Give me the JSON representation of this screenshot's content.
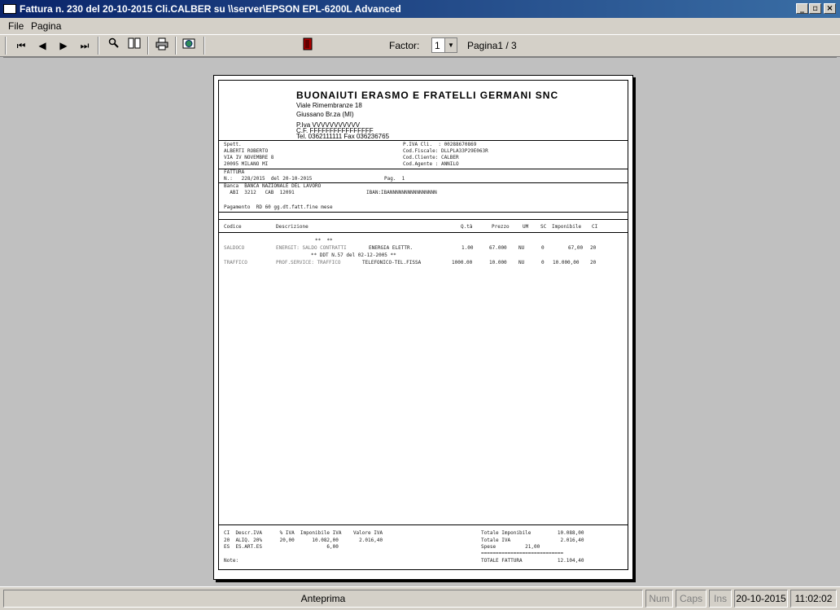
{
  "window": {
    "title": "Fattura n.  230 del 20-10-2015 Cli.CALBER su \\\\server\\EPSON EPL-6200L Advanced",
    "buttons": {
      "minimize": "_",
      "restore": "▫",
      "close": "×"
    }
  },
  "menu": {
    "file": "File",
    "pagina": "Pagina"
  },
  "toolbar": {
    "icons": [
      "first-page-icon",
      "prev-page-icon",
      "next-page-icon",
      "last-page-icon",
      "zoom-icon",
      "two-pages-icon",
      "print-icon",
      "export-icon",
      "exit-icon"
    ],
    "factor_label": "Factor:",
    "factor_value": "1",
    "page_label": "Pagina1 / 3"
  },
  "invoice": {
    "company": {
      "name": "BUONAIUTI ERASMO E FRATELLI GERMANI  SNC",
      "address": "Viale Rimembranze 18",
      "city": "Giussano Br.za (MI)",
      "piva": "P.Iva VVVVVVVVVVV",
      "cf": "C.F. FFFFFFFFFFFFFFFF",
      "tel": "Tel. 0362111111   Fax 036236765"
    },
    "customer": {
      "spett": "Spett.",
      "name": "ALBERTI ROBERTO",
      "street": "VIA IV NOVEMBRE 8",
      "city": "20095 MILANO MI",
      "piva_cli": "P.IVA Cli.  : 00288670869",
      "cod_fiscale": "Cod.Fiscale: DLLPLA33P29E063R",
      "cod_cliente": "Cod.Cliente: CALBER",
      "cod_agente": "Cod.Agente : ANNILO"
    },
    "doc": {
      "type": "FATTURA",
      "number": "N.:   228/2015  del 20-10-2015",
      "page": "Pag.  1"
    },
    "bank": {
      "banca": "Banca  BANCA NAZIONALE DEL LAVORO",
      "abi": "  ABI  3212   CAB  12091",
      "iban": "IBAN:IBANNNNNNNNNNNNNNNN",
      "pagamento": "Pagamento  RD 60 gg.dt.fatt.fine mese"
    },
    "columns": {
      "codice": "Codice",
      "descrizione": "Descrizione",
      "qta": "Q.tà",
      "prezzo": "Prezzo",
      "um": "UM",
      "sc": "SC",
      "imponibile": "Imponibile",
      "ci": "CI"
    },
    "rows": [
      {
        "marker": "**  **"
      },
      {
        "codice": "SALDOCO",
        "descr_gray": "ENERGIT: SALDO CONTRATTI",
        "descr": "ENERGIA ELETTR.",
        "qta": "1.00",
        "prezzo": "67.000",
        "um": "NU",
        "sc": "0",
        "imponibile": "67,00",
        "ci": "20"
      },
      {
        "ddt": "** DDT N.57 del 02-12-2005 **"
      },
      {
        "codice": "TRAFFICO",
        "descr_gray": "PROF.SERVICE: TRAFFICO",
        "descr": "TELEFONICO-TEL.FISSA",
        "qta": "1000.00",
        "prezzo": "10.000",
        "um": "NU",
        "sc": "0",
        "imponibile": "10.000,00",
        "ci": "20"
      }
    ],
    "footer": {
      "iva_header": "CI  Descr.IVA      % IVA  Imponibile IVA    Valore IVA",
      "iva_row1": "20  ALIQ. 20%      20,00      10.082,00       2.016,40",
      "iva_row2": "ES  ES.ART.ES                      6,00",
      "note": "Note:",
      "totale_imponibile": "Totale Imponibile         10.088,00",
      "totale_iva": "Totale IVA                 2.016,40",
      "spese": "Spese          21,00",
      "separator": "============================",
      "totale_fattura": "TOTALE FATTURA            12.104,40"
    }
  },
  "status": {
    "anteprima": "Anteprima",
    "num": "Num",
    "caps": "Caps",
    "ins": "Ins",
    "date": "20-10-2015",
    "time": "11:02:02"
  }
}
